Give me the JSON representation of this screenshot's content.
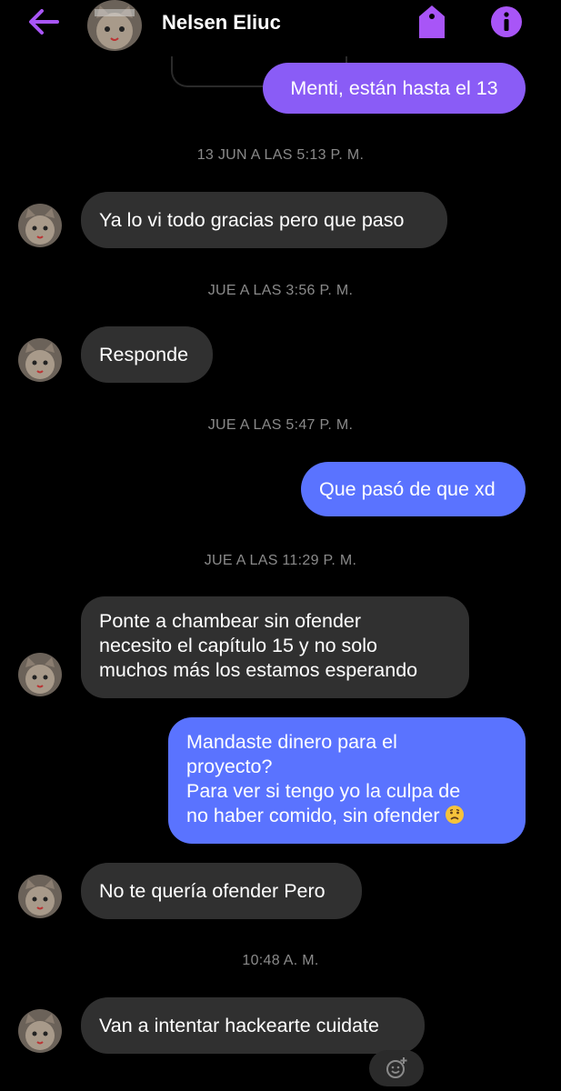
{
  "header": {
    "contact_name": "Nelsen Eliuc",
    "accent_color": "#a855f7",
    "icons": [
      "back-arrow-icon",
      "tag-icon",
      "info-icon"
    ]
  },
  "messages": [
    {
      "type": "outgoing",
      "text": "Menti, están hasta el 13"
    },
    {
      "type": "timestamp",
      "text": "13 JUN A LAS 5:13 P. M."
    },
    {
      "type": "incoming",
      "text": "Ya lo vi todo gracias pero que paso"
    },
    {
      "type": "timestamp",
      "text": "JUE A LAS 3:56 P. M."
    },
    {
      "type": "incoming",
      "text": "Responde"
    },
    {
      "type": "timestamp",
      "text": "JUE A LAS 5:47 P. M."
    },
    {
      "type": "outgoing",
      "text": "Que pasó de que xd"
    },
    {
      "type": "timestamp",
      "text": "JUE A LAS 11:29 P. M."
    },
    {
      "type": "incoming",
      "text": "Ponte a chambear sin ofender\nnecesito el capítulo 15 y no solo\nmuchos más los estamos esperando"
    },
    {
      "type": "outgoing",
      "text": "Mandaste dinero para el\nproyecto?\nPara ver si tengo yo la culpa de\nno haber comido, sin ofender",
      "emoji": "worried-face"
    },
    {
      "type": "incoming",
      "text": "No te quería ofender Pero"
    },
    {
      "type": "timestamp",
      "text": "10:48 A. M."
    },
    {
      "type": "incoming",
      "text": "Van a intentar hackearte cuidate"
    }
  ],
  "reaction_button": {
    "icon": "add-reaction-icon"
  }
}
